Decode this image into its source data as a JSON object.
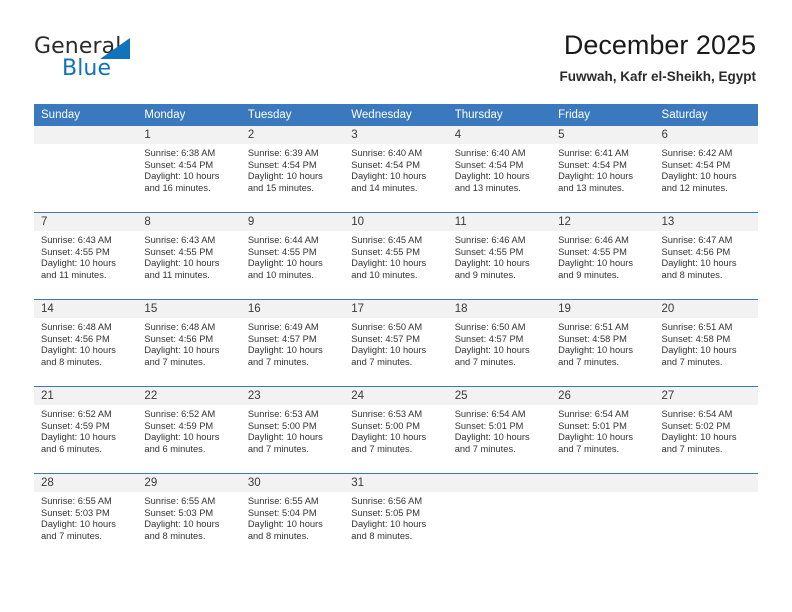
{
  "brand": {
    "name_part1": "General",
    "name_part2": "Blue",
    "triangle_color": "#1273bd"
  },
  "header": {
    "title": "December 2025",
    "subtitle": "Fuwwah, Kafr el-Sheikh, Egypt"
  },
  "theme": {
    "header_blue": "#3a79bd",
    "daynum_band": "#f2f2f2",
    "text": "#333333"
  },
  "calendar": {
    "weekday_headers": [
      "Sunday",
      "Monday",
      "Tuesday",
      "Wednesday",
      "Thursday",
      "Friday",
      "Saturday"
    ],
    "weeks": [
      [
        {
          "day": "",
          "lines": []
        },
        {
          "day": "1",
          "lines": [
            "Sunrise: 6:38 AM",
            "Sunset: 4:54 PM",
            "Daylight: 10 hours",
            "and 16 minutes."
          ]
        },
        {
          "day": "2",
          "lines": [
            "Sunrise: 6:39 AM",
            "Sunset: 4:54 PM",
            "Daylight: 10 hours",
            "and 15 minutes."
          ]
        },
        {
          "day": "3",
          "lines": [
            "Sunrise: 6:40 AM",
            "Sunset: 4:54 PM",
            "Daylight: 10 hours",
            "and 14 minutes."
          ]
        },
        {
          "day": "4",
          "lines": [
            "Sunrise: 6:40 AM",
            "Sunset: 4:54 PM",
            "Daylight: 10 hours",
            "and 13 minutes."
          ]
        },
        {
          "day": "5",
          "lines": [
            "Sunrise: 6:41 AM",
            "Sunset: 4:54 PM",
            "Daylight: 10 hours",
            "and 13 minutes."
          ]
        },
        {
          "day": "6",
          "lines": [
            "Sunrise: 6:42 AM",
            "Sunset: 4:54 PM",
            "Daylight: 10 hours",
            "and 12 minutes."
          ]
        }
      ],
      [
        {
          "day": "7",
          "lines": [
            "Sunrise: 6:43 AM",
            "Sunset: 4:55 PM",
            "Daylight: 10 hours",
            "and 11 minutes."
          ]
        },
        {
          "day": "8",
          "lines": [
            "Sunrise: 6:43 AM",
            "Sunset: 4:55 PM",
            "Daylight: 10 hours",
            "and 11 minutes."
          ]
        },
        {
          "day": "9",
          "lines": [
            "Sunrise: 6:44 AM",
            "Sunset: 4:55 PM",
            "Daylight: 10 hours",
            "and 10 minutes."
          ]
        },
        {
          "day": "10",
          "lines": [
            "Sunrise: 6:45 AM",
            "Sunset: 4:55 PM",
            "Daylight: 10 hours",
            "and 10 minutes."
          ]
        },
        {
          "day": "11",
          "lines": [
            "Sunrise: 6:46 AM",
            "Sunset: 4:55 PM",
            "Daylight: 10 hours",
            "and 9 minutes."
          ]
        },
        {
          "day": "12",
          "lines": [
            "Sunrise: 6:46 AM",
            "Sunset: 4:55 PM",
            "Daylight: 10 hours",
            "and 9 minutes."
          ]
        },
        {
          "day": "13",
          "lines": [
            "Sunrise: 6:47 AM",
            "Sunset: 4:56 PM",
            "Daylight: 10 hours",
            "and 8 minutes."
          ]
        }
      ],
      [
        {
          "day": "14",
          "lines": [
            "Sunrise: 6:48 AM",
            "Sunset: 4:56 PM",
            "Daylight: 10 hours",
            "and 8 minutes."
          ]
        },
        {
          "day": "15",
          "lines": [
            "Sunrise: 6:48 AM",
            "Sunset: 4:56 PM",
            "Daylight: 10 hours",
            "and 7 minutes."
          ]
        },
        {
          "day": "16",
          "lines": [
            "Sunrise: 6:49 AM",
            "Sunset: 4:57 PM",
            "Daylight: 10 hours",
            "and 7 minutes."
          ]
        },
        {
          "day": "17",
          "lines": [
            "Sunrise: 6:50 AM",
            "Sunset: 4:57 PM",
            "Daylight: 10 hours",
            "and 7 minutes."
          ]
        },
        {
          "day": "18",
          "lines": [
            "Sunrise: 6:50 AM",
            "Sunset: 4:57 PM",
            "Daylight: 10 hours",
            "and 7 minutes."
          ]
        },
        {
          "day": "19",
          "lines": [
            "Sunrise: 6:51 AM",
            "Sunset: 4:58 PM",
            "Daylight: 10 hours",
            "and 7 minutes."
          ]
        },
        {
          "day": "20",
          "lines": [
            "Sunrise: 6:51 AM",
            "Sunset: 4:58 PM",
            "Daylight: 10 hours",
            "and 7 minutes."
          ]
        }
      ],
      [
        {
          "day": "21",
          "lines": [
            "Sunrise: 6:52 AM",
            "Sunset: 4:59 PM",
            "Daylight: 10 hours",
            "and 6 minutes."
          ]
        },
        {
          "day": "22",
          "lines": [
            "Sunrise: 6:52 AM",
            "Sunset: 4:59 PM",
            "Daylight: 10 hours",
            "and 6 minutes."
          ]
        },
        {
          "day": "23",
          "lines": [
            "Sunrise: 6:53 AM",
            "Sunset: 5:00 PM",
            "Daylight: 10 hours",
            "and 7 minutes."
          ]
        },
        {
          "day": "24",
          "lines": [
            "Sunrise: 6:53 AM",
            "Sunset: 5:00 PM",
            "Daylight: 10 hours",
            "and 7 minutes."
          ]
        },
        {
          "day": "25",
          "lines": [
            "Sunrise: 6:54 AM",
            "Sunset: 5:01 PM",
            "Daylight: 10 hours",
            "and 7 minutes."
          ]
        },
        {
          "day": "26",
          "lines": [
            "Sunrise: 6:54 AM",
            "Sunset: 5:01 PM",
            "Daylight: 10 hours",
            "and 7 minutes."
          ]
        },
        {
          "day": "27",
          "lines": [
            "Sunrise: 6:54 AM",
            "Sunset: 5:02 PM",
            "Daylight: 10 hours",
            "and 7 minutes."
          ]
        }
      ],
      [
        {
          "day": "28",
          "lines": [
            "Sunrise: 6:55 AM",
            "Sunset: 5:03 PM",
            "Daylight: 10 hours",
            "and 7 minutes."
          ]
        },
        {
          "day": "29",
          "lines": [
            "Sunrise: 6:55 AM",
            "Sunset: 5:03 PM",
            "Daylight: 10 hours",
            "and 8 minutes."
          ]
        },
        {
          "day": "30",
          "lines": [
            "Sunrise: 6:55 AM",
            "Sunset: 5:04 PM",
            "Daylight: 10 hours",
            "and 8 minutes."
          ]
        },
        {
          "day": "31",
          "lines": [
            "Sunrise: 6:56 AM",
            "Sunset: 5:05 PM",
            "Daylight: 10 hours",
            "and 8 minutes."
          ]
        },
        {
          "day": "",
          "lines": []
        },
        {
          "day": "",
          "lines": []
        },
        {
          "day": "",
          "lines": []
        }
      ]
    ]
  }
}
